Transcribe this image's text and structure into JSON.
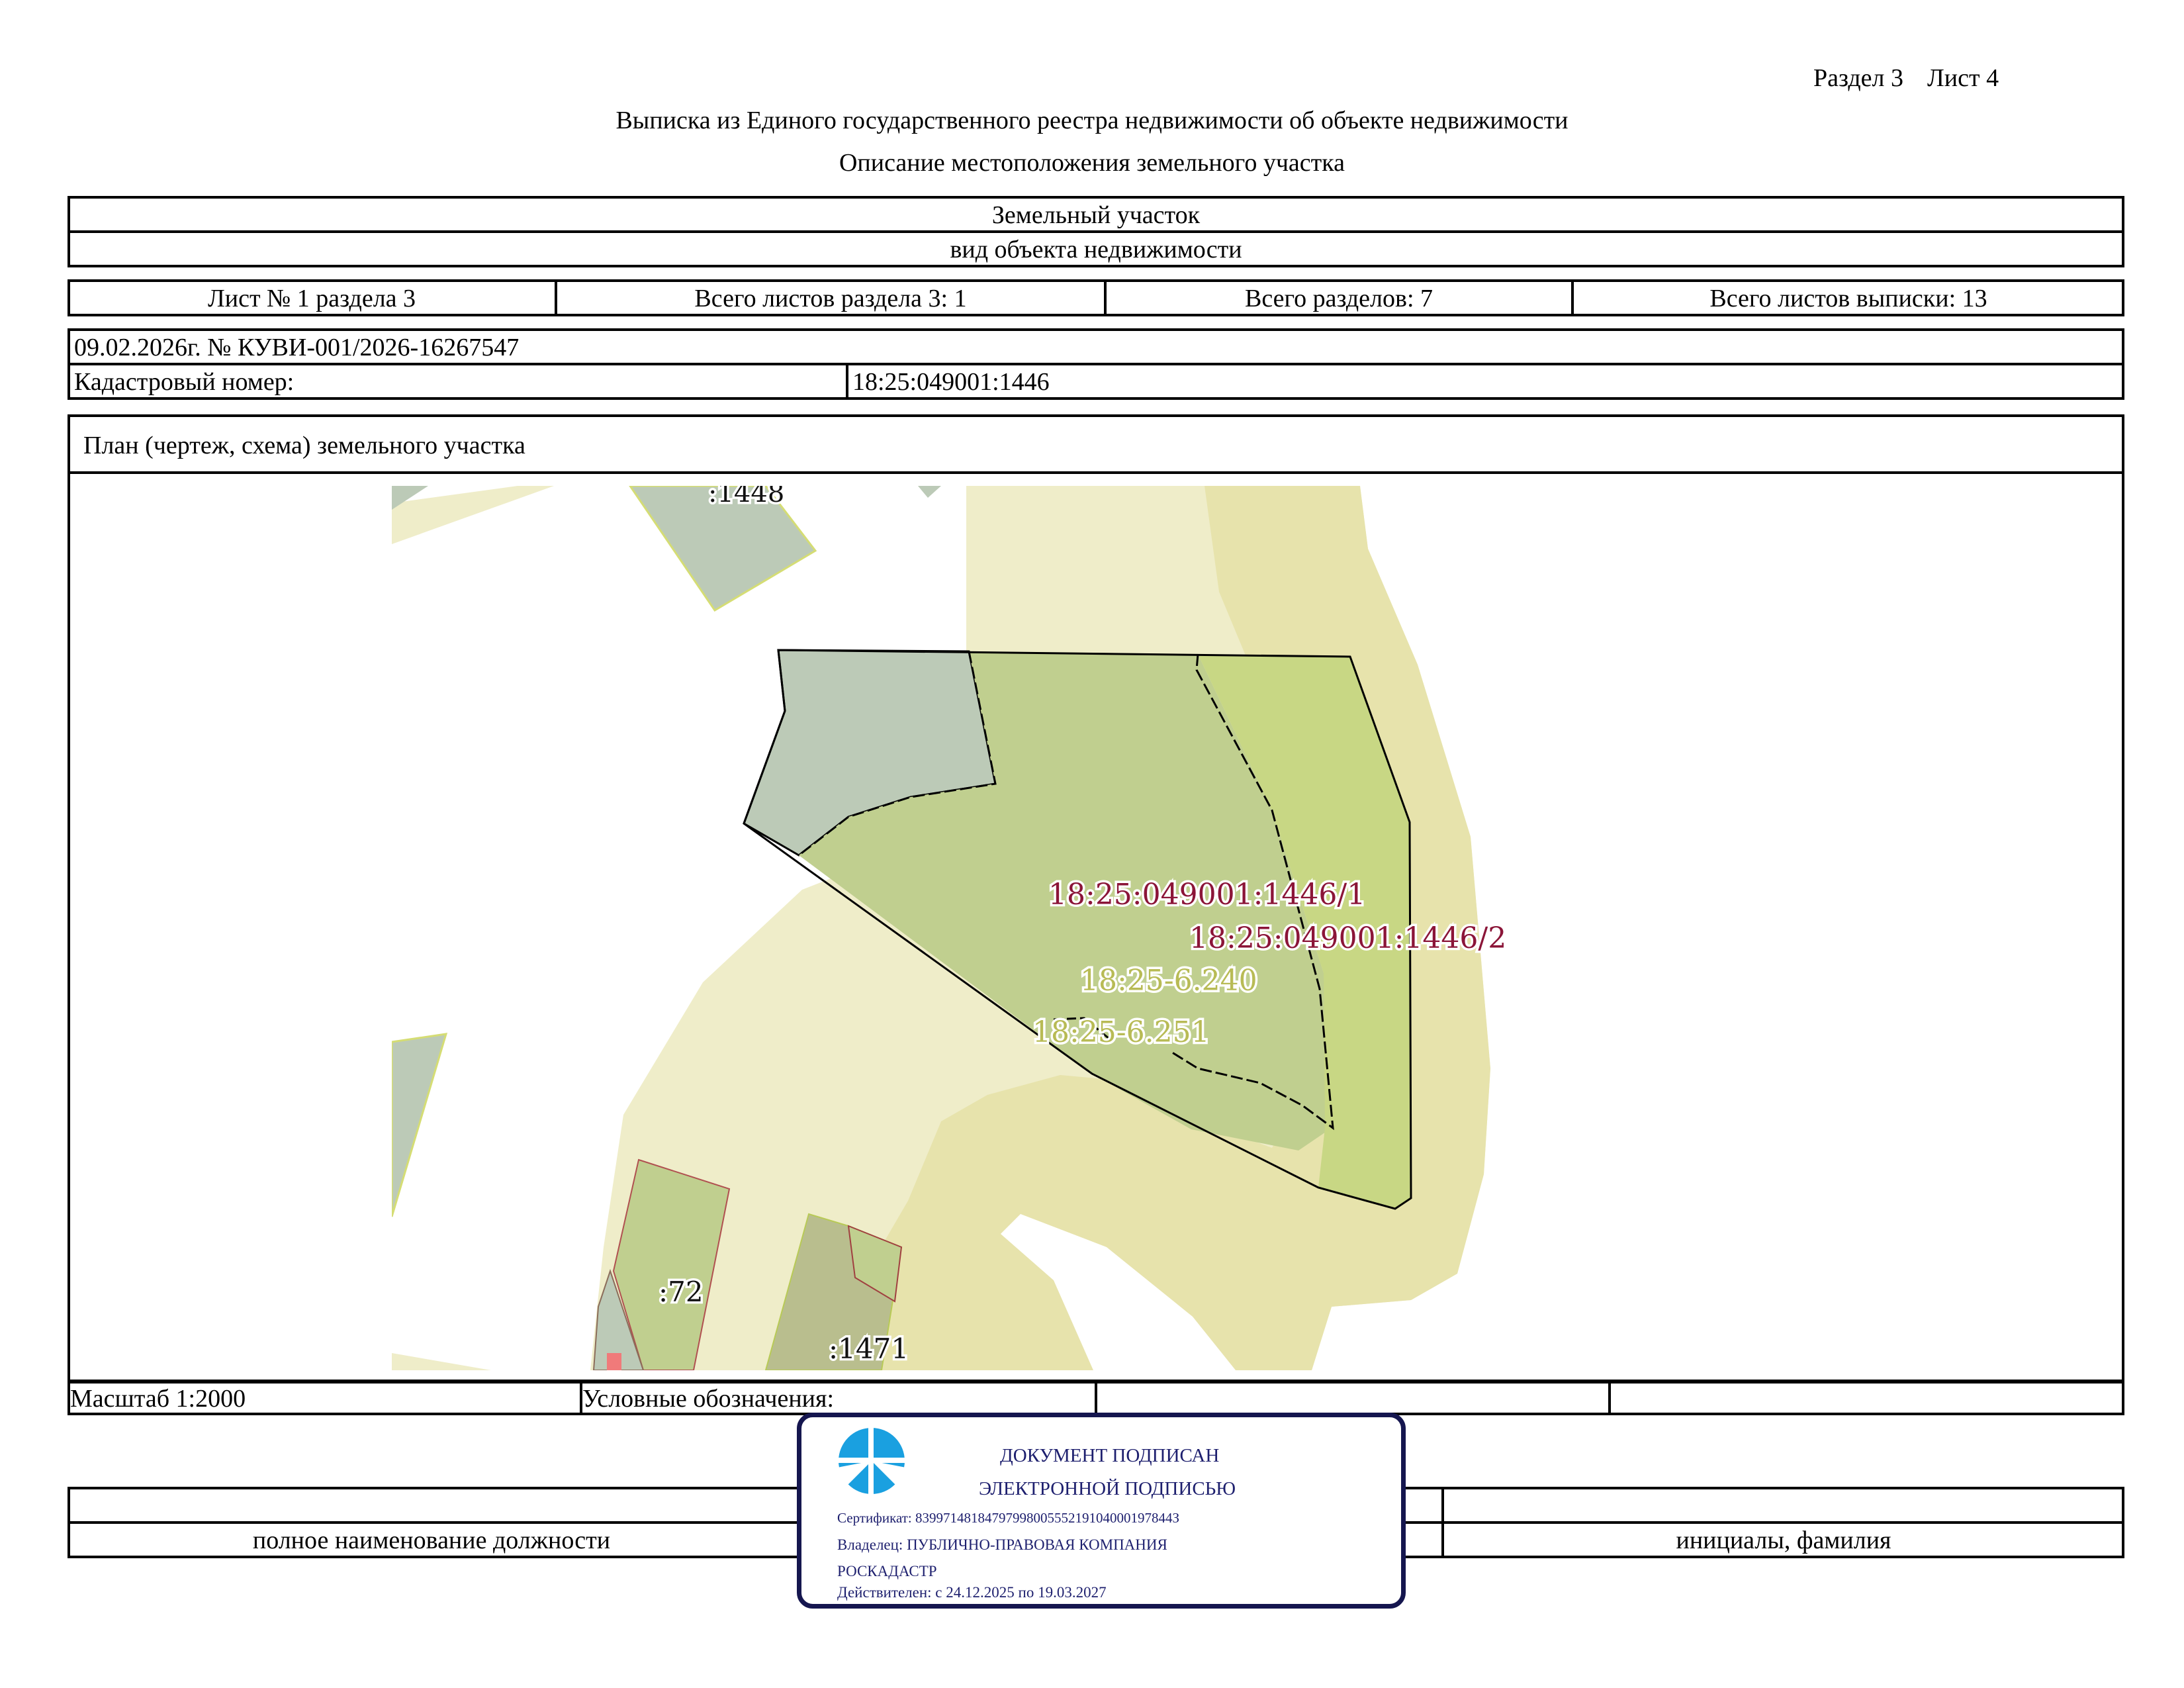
{
  "header": {
    "section": "Раздел 3",
    "sheet": "Лист 4",
    "title": "Выписка из Единого государственного реестра недвижимости об объекте недвижимости",
    "subtitle": "Описание местоположения земельного участка"
  },
  "object": {
    "type_value": "Земельный участок",
    "type_caption": "вид объекта недвижимости"
  },
  "sheets": {
    "sheet_no": "Лист № 1 раздела 3",
    "total_sheets_section": "Всего листов раздела 3: 1",
    "total_sections": "Всего разделов: 7",
    "total_sheets_extract": "Всего листов выписки: 13"
  },
  "record": {
    "date_number": "09.02.2026г. № КУВИ-001/2026-16267547",
    "cadastral_label": "Кадастровый номер:",
    "cadastral_value": "18:25:049001:1446"
  },
  "plan": {
    "caption": "План (чертеж, схема) земельного участка",
    "labels": {
      "parcel_1448": ":1448",
      "subparcel_1": "18:25:049001:1446/1",
      "subparcel_2": "18:25:049001:1446/2",
      "zone_240": "18:25-6.240",
      "zone_251": "18:25-6.251",
      "parcel_72": ":72",
      "parcel_1471": ":1471"
    },
    "colors": {
      "zone_light": "#efedc9",
      "zone_mid": "#e7e3ac",
      "parcel_grey": "#bccab7",
      "parcel_green": "#c0cf8f",
      "parcel_green_bright": "#c8d784",
      "label_purple": "#8b1538",
      "label_olive": "#b8bb55"
    }
  },
  "footer": {
    "scale": "Масштаб 1:2000",
    "legend": "Условные обозначения:",
    "position_caption": "полное наименование должности",
    "name_caption": "инициалы, фамилия"
  },
  "stamp": {
    "line1": "ДОКУМЕНТ ПОДПИСАН",
    "line2": "ЭЛЕКТРОННОЙ ПОДПИСЬЮ",
    "certificate": "Сертификат: 8399714818479799800555219104000197844З",
    "owner_line1": "Владелец: ПУБЛИЧНО-ПРАВОВАЯ КОМПАНИЯ",
    "owner_line2": "РОСКАДАСТР",
    "valid": "Действителен: с 24.12.2025 по 19.03.2027",
    "logo_icon": "roskadastr-logo-icon",
    "border_color": "#15164f"
  }
}
